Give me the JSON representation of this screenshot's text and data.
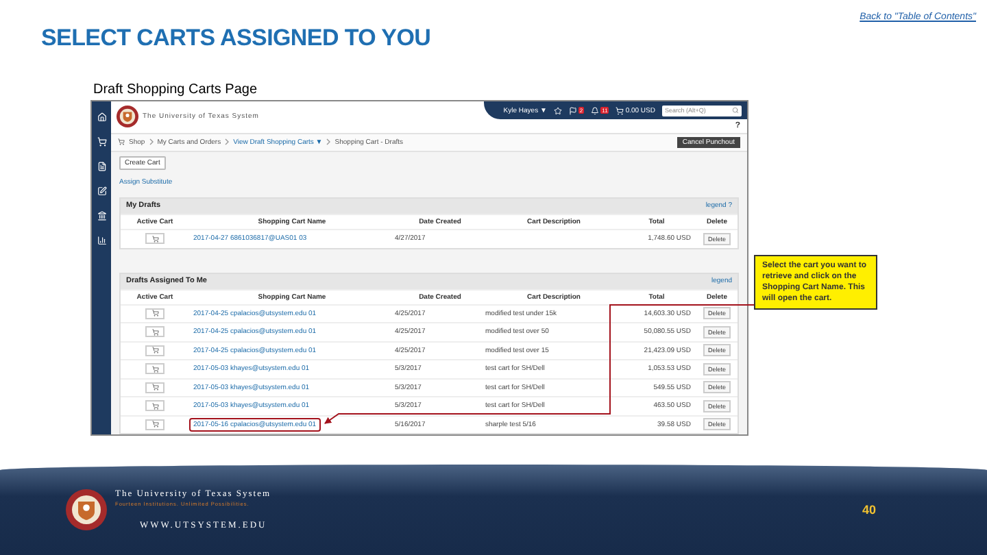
{
  "slide": {
    "title": "SELECT CARTS ASSIGNED TO YOU",
    "back_link": "Back to \"Table of Contents\"",
    "caption": "Draft Shopping Carts Page"
  },
  "app": {
    "org_name": "The University of Texas System",
    "user": "Kyle Hayes ▼",
    "flag_count": "2",
    "bell_count": "11",
    "cart_total": "0.00 USD",
    "search": {
      "placeholder": "Search (Alt+Q)"
    },
    "help": "?",
    "breadcrumb": [
      "Shop",
      "My Carts and Orders",
      "View Draft Shopping Carts ▼",
      "Shopping Cart - Drafts"
    ],
    "cancel_button": "Cancel Punchout",
    "create_button": "Create Cart",
    "assign_link": "Assign Substitute",
    "my_drafts": {
      "title": "My Drafts",
      "legend": "legend ?",
      "columns": [
        "Active Cart",
        "Shopping Cart Name",
        "Date Created",
        "Cart Description",
        "Total",
        "Delete"
      ],
      "rows": [
        {
          "name": "2017-04-27 6861036817@UAS01 03",
          "date": "4/27/2017",
          "description": "",
          "total": "1,748.60 USD",
          "delete": "Delete",
          "highlighted": false
        }
      ]
    },
    "assigned": {
      "title": "Drafts Assigned To Me",
      "legend": "legend",
      "columns": [
        "Active Cart",
        "Shopping Cart Name",
        "Date Created",
        "Cart Description",
        "Total",
        "Delete"
      ],
      "rows": [
        {
          "name": "2017-04-25 cpalacios@utsystem.edu 01",
          "date": "4/25/2017",
          "description": "modified test under 15k",
          "total": "14,603.30 USD",
          "delete": "Delete",
          "highlighted": false
        },
        {
          "name": "2017-04-25 cpalacios@utsystem.edu 01",
          "date": "4/25/2017",
          "description": "modified test over 50",
          "total": "50,080.55 USD",
          "delete": "Delete",
          "highlighted": false
        },
        {
          "name": "2017-04-25 cpalacios@utsystem.edu 01",
          "date": "4/25/2017",
          "description": "modified test over 15",
          "total": "21,423.09 USD",
          "delete": "Delete",
          "highlighted": false
        },
        {
          "name": "2017-05-03 khayes@utsystem.edu 01",
          "date": "5/3/2017",
          "description": "test cart for SH/Dell",
          "total": "1,053.53 USD",
          "delete": "Delete",
          "highlighted": false
        },
        {
          "name": "2017-05-03 khayes@utsystem.edu 01",
          "date": "5/3/2017",
          "description": "test cart for SH/Dell",
          "total": "549.55 USD",
          "delete": "Delete",
          "highlighted": false
        },
        {
          "name": "2017-05-03 khayes@utsystem.edu 01",
          "date": "5/3/2017",
          "description": "test cart for SH/Dell",
          "total": "463.50 USD",
          "delete": "Delete",
          "highlighted": false
        },
        {
          "name": "2017-05-16 cpalacios@utsystem.edu 01",
          "date": "5/16/2017",
          "description": "sharple test 5/16",
          "total": "39.58 USD",
          "delete": "Delete",
          "highlighted": true
        }
      ]
    }
  },
  "callout": "Select the cart you want to retrieve and click on the Shopping Cart Name. This will open the cart.",
  "footer": {
    "org_name": "The University of Texas System",
    "tagline": "Fourteen Institutions. Unlimited Possibilities.",
    "url": "WWW.UTSYSTEM.EDU",
    "page_number": "40"
  }
}
